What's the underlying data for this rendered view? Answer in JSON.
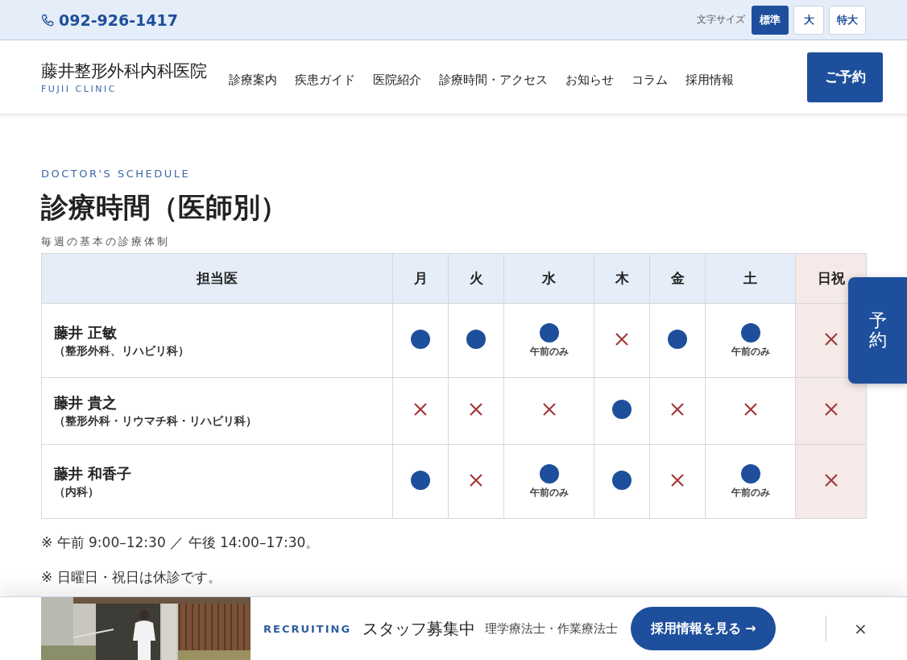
{
  "topbar": {
    "phone": "092-926-1417",
    "font_size_label": "文字サイズ",
    "font_sizes": [
      {
        "label": "標準",
        "selected": true
      },
      {
        "label": "大",
        "selected": false
      },
      {
        "label": "特大",
        "selected": false
      }
    ]
  },
  "header": {
    "logo": "藤井整形外科内科医院",
    "logo_sub": "FUJII CLINIC",
    "nav": [
      "診療案内",
      "疾患ガイド",
      "医院紹介",
      "診療時間・アクセス",
      "お知らせ",
      "コラム",
      "採用情報"
    ],
    "reserve_button": "ご予約"
  },
  "section": {
    "eyebrow": "DOCTOR'S SCHEDULE",
    "title": "診療時間（医師別）",
    "subtitle": "毎週の基本の診療体制"
  },
  "schedule": {
    "columns": [
      {
        "label": "担当医",
        "holiday": false
      },
      {
        "label": "月",
        "holiday": false
      },
      {
        "label": "火",
        "holiday": false
      },
      {
        "label": "水",
        "holiday": false
      },
      {
        "label": "木",
        "holiday": false
      },
      {
        "label": "金",
        "holiday": false
      },
      {
        "label": "土",
        "holiday": false
      },
      {
        "label": "日祝",
        "holiday": true
      }
    ],
    "rows": [
      {
        "name": "藤井 正敏",
        "dept": "（整形外科、リハビリ科）",
        "cells": [
          {
            "kind": "open"
          },
          {
            "kind": "open"
          },
          {
            "kind": "open",
            "note": "午前のみ"
          },
          {
            "kind": "closed"
          },
          {
            "kind": "open"
          },
          {
            "kind": "open",
            "note": "午前のみ"
          },
          {
            "kind": "closed"
          }
        ]
      },
      {
        "name": "藤井 貴之",
        "dept": "（整形外科・リウマチ科・リハビリ科）",
        "cells": [
          {
            "kind": "closed"
          },
          {
            "kind": "closed"
          },
          {
            "kind": "closed"
          },
          {
            "kind": "open"
          },
          {
            "kind": "closed"
          },
          {
            "kind": "closed"
          },
          {
            "kind": "closed"
          }
        ]
      },
      {
        "name": "藤井 和香子",
        "dept": "（内科）",
        "cells": [
          {
            "kind": "open"
          },
          {
            "kind": "closed"
          },
          {
            "kind": "open",
            "note": "午前のみ"
          },
          {
            "kind": "open"
          },
          {
            "kind": "closed"
          },
          {
            "kind": "open",
            "note": "午前のみ"
          },
          {
            "kind": "closed"
          }
        ]
      }
    ]
  },
  "notes": [
    "※ 午前 9:00–12:30 ／ 午後 14:00–17:30。",
    "※ 日曜日・祝日は休診です。"
  ],
  "side_tab": "予約",
  "recruit": {
    "eyebrow": "RECRUITING",
    "title": "スタッフ募集中",
    "roles": "理学療法士・作業療法士",
    "button": "採用情報を見る →",
    "close": "×"
  }
}
